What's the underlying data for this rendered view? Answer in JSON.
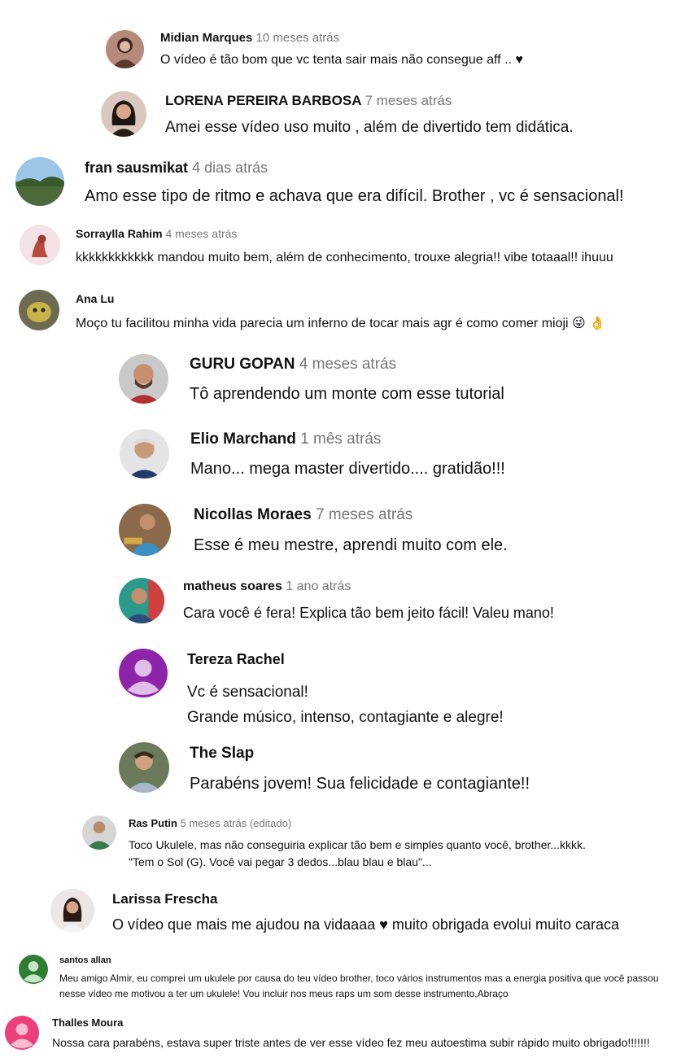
{
  "comments": [
    {
      "author": "Midian Marques",
      "time": "10 meses atrás",
      "lines": [
        "O vídeo é tão bom que vc tenta sair mais não consegue aff .. ♥"
      ]
    },
    {
      "author": "LORENA PEREIRA BARBOSA",
      "time": "7 meses atrás",
      "lines": [
        "Amei esse vídeo uso muito , além de divertido tem didática."
      ]
    },
    {
      "author": "fran sausmikat",
      "time": "4 dias atrás",
      "lines": [
        "Amo esse tipo de ritmo e achava que era difícil. Brother , vc é sensacional!"
      ]
    },
    {
      "author": "Sorraylla Rahim",
      "time": "4 meses atrás",
      "lines": [
        "kkkkkkkkkkkk mandou muito bem, além de conhecimento, trouxe alegria!! vibe totaaal!! ihuuu"
      ]
    },
    {
      "author": "Ana Lu",
      "time": "",
      "lines": [
        "Moço tu facilitou minha vida  parecia um inferno de tocar mais agr é como comer mioji 😜 👌"
      ]
    },
    {
      "author": "GURU GOPAN",
      "time": "4 meses atrás",
      "lines": [
        "Tô aprendendo um monte com esse tutorial"
      ]
    },
    {
      "author": "Elio Marchand",
      "time": "1 mês atrás",
      "lines": [
        "Mano... mega master divertido.... gratidão!!!"
      ]
    },
    {
      "author": "Nicollas Moraes",
      "time": "7 meses atrás",
      "lines": [
        "Esse é meu mestre, aprendi muito com ele."
      ]
    },
    {
      "author": "matheus soares",
      "time": "1 ano atrás",
      "lines": [
        "Cara você é fera! Explica tão bem jeito fácil! Valeu mano!"
      ]
    },
    {
      "author": "Tereza Rachel",
      "time": "",
      "lines": [
        "Vc é sensacional!",
        "Grande músico,  intenso, contagiante e alegre!"
      ]
    },
    {
      "author": "The Slap",
      "time": "",
      "lines": [
        "Parabéns jovem! Sua felicidade e contagiante!!"
      ]
    },
    {
      "author": "Ras Putin",
      "time": "5 meses atrás (editado)",
      "lines": [
        "Toco Ukulele, mas não conseguiria explicar tão bem e simples quanto você, brother...kkkk.",
        "\"Tem o Sol (G). Você vai pegar 3 dedos...blau  blau e blau\"..."
      ]
    },
    {
      "author": "Larissa Frescha",
      "time": "",
      "lines": [
        "O vídeo que mais me ajudou na vidaaaa ♥ muito obrigada evolui muito caraca"
      ]
    },
    {
      "author": "santos allan",
      "time": "",
      "lines": [
        "Meu amigo Almir, eu comprei um ukulele por causa do teu vídeo brother, toco vários instrumentos mas a energia positiva que você passou",
        "nesse vídeo me motivou a ter um ukulele! Vou incluir nos meus raps um som desse instrumento,Abraço"
      ]
    },
    {
      "author": "Thalles Moura",
      "time": "",
      "lines": [
        "Nossa cara parabéns, estava super triste antes de ver esse vídeo fez meu autoestima subir rápido muito obrigado!!!!!!!"
      ]
    }
  ]
}
